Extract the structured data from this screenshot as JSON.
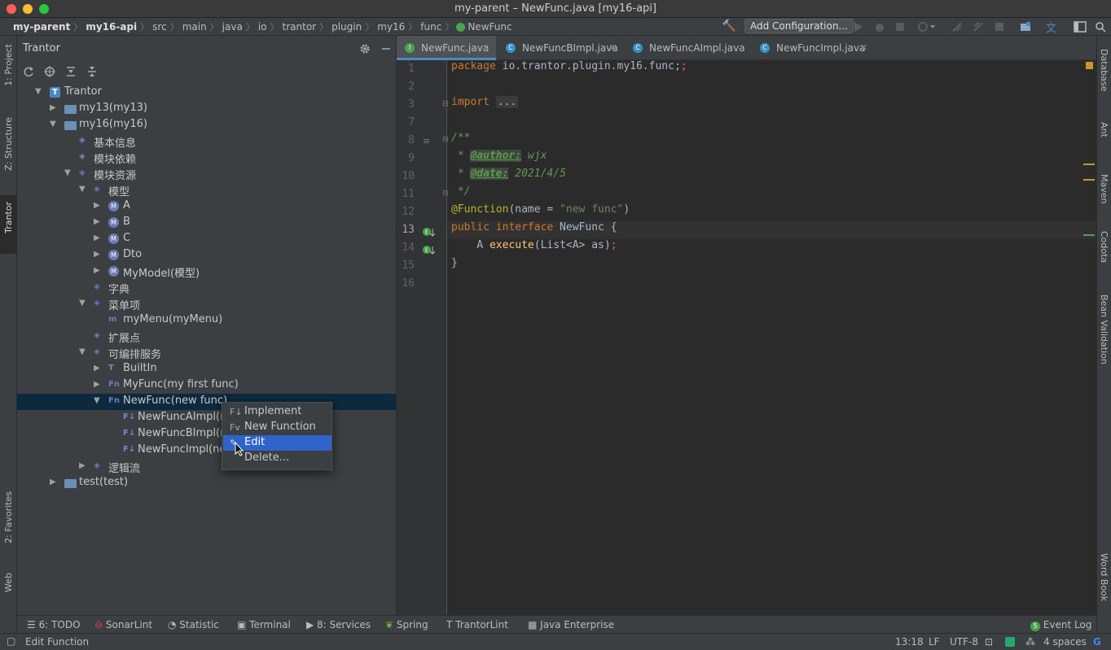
{
  "window": {
    "title": "my-parent – NewFunc.java [my16-api]"
  },
  "breadcrumbs": [
    "my-parent",
    "my16-api",
    "src",
    "main",
    "java",
    "io",
    "trantor",
    "plugin",
    "my16",
    "func",
    "NewFunc"
  ],
  "toolbar": {
    "add_configuration": "Add Configuration..."
  },
  "left_tabs": {
    "project": "1: Project",
    "structure": "Z: Structure",
    "trantor": "Trantor",
    "favorites": "2: Favorites",
    "web": "Web"
  },
  "right_tabs": {
    "database": "Database",
    "ant": "Ant",
    "maven": "Maven",
    "codota": "Codota",
    "bean_validation": "Bean Validation",
    "word_book": "Word Book"
  },
  "project_panel": {
    "title": "Trantor",
    "tree": [
      {
        "label": "Trantor",
        "depth": 0,
        "state": "open",
        "icon": "trantor-icon"
      },
      {
        "label": "my13(my13)",
        "depth": 1,
        "state": "closed",
        "icon": "folder-icon"
      },
      {
        "label": "my16(my16)",
        "depth": 1,
        "state": "open",
        "icon": "folder-icon"
      },
      {
        "label": "基本信息",
        "depth": 2,
        "state": "none",
        "icon": "info-icon"
      },
      {
        "label": "模块依赖",
        "depth": 2,
        "state": "none",
        "icon": "dependency-icon"
      },
      {
        "label": "模块资源",
        "depth": 2,
        "state": "open",
        "icon": "globe-icon"
      },
      {
        "label": "模型",
        "depth": 3,
        "state": "open",
        "icon": "model-icon"
      },
      {
        "label": "A",
        "depth": 4,
        "state": "closed",
        "icon": "model-m-icon"
      },
      {
        "label": "B",
        "depth": 4,
        "state": "closed",
        "icon": "model-m-icon"
      },
      {
        "label": "C",
        "depth": 4,
        "state": "closed",
        "icon": "model-m-icon"
      },
      {
        "label": "Dto",
        "depth": 4,
        "state": "closed",
        "icon": "model-m-icon"
      },
      {
        "label": "MyModel(模型)",
        "depth": 4,
        "state": "closed",
        "icon": "model-m-icon"
      },
      {
        "label": "字典",
        "depth": 3,
        "state": "none",
        "icon": "dictionary-icon"
      },
      {
        "label": "菜单项",
        "depth": 3,
        "state": "open",
        "icon": "menu-icon"
      },
      {
        "label": "myMenu(myMenu)",
        "depth": 4,
        "state": "none",
        "icon": "menu-item-icon"
      },
      {
        "label": "扩展点",
        "depth": 3,
        "state": "none",
        "icon": "extension-icon"
      },
      {
        "label": "可编排服务",
        "depth": 3,
        "state": "open",
        "icon": "service-icon"
      },
      {
        "label": "BuiltIn",
        "depth": 4,
        "state": "closed",
        "icon": "builtin-icon"
      },
      {
        "label": "MyFunc(my first func)",
        "depth": 4,
        "state": "closed",
        "icon": "function-icon"
      },
      {
        "label": "NewFunc(new func)",
        "depth": 4,
        "state": "open",
        "icon": "function-icon",
        "selected": true
      },
      {
        "label": "NewFuncAImpl(new",
        "depth": 5,
        "state": "none",
        "icon": "impl-icon"
      },
      {
        "label": "NewFuncBImpl(new",
        "depth": 5,
        "state": "none",
        "icon": "impl-icon"
      },
      {
        "label": "NewFuncImpl(new",
        "depth": 5,
        "state": "none",
        "icon": "impl-icon"
      },
      {
        "label": "逻辑流",
        "depth": 3,
        "state": "closed",
        "icon": "flow-icon"
      },
      {
        "label": "test(test)",
        "depth": 1,
        "state": "closed",
        "icon": "folder-icon"
      }
    ]
  },
  "context_menu": {
    "items": [
      {
        "label": "Implement",
        "icon": "implement-icon"
      },
      {
        "label": "New Function",
        "icon": "new-function-icon"
      },
      {
        "label": "Edit",
        "icon": "pencil-icon",
        "highlighted": true
      },
      {
        "label": "Delete...",
        "icon": ""
      }
    ]
  },
  "editor": {
    "tabs": [
      {
        "label": "NewFunc.java",
        "active": true,
        "icon_letter": "I",
        "icon_color": "#4ba34b"
      },
      {
        "label": "NewFuncBImpl.java",
        "active": false,
        "icon_letter": "C",
        "icon_color": "#3592c4"
      },
      {
        "label": "NewFuncAImpl.java",
        "active": false,
        "icon_letter": "C",
        "icon_color": "#3592c4"
      },
      {
        "label": "NewFuncImpl.java",
        "active": false,
        "icon_letter": "C",
        "icon_color": "#3592c4"
      }
    ],
    "line_numbers": [
      "1",
      "2",
      "3",
      "7",
      "8",
      "9",
      "10",
      "11",
      "12",
      "13",
      "14",
      "15",
      "16"
    ],
    "current_line": "13",
    "code": {
      "l1_kw": "package",
      "l1_rest": " io.trantor.plugin.my16.func;",
      "l3_kw": "import",
      "l3_fold": "...",
      "l8": "/**",
      "l9_star": " * ",
      "l9_tag": "@author:",
      "l9_val": " wjx",
      "l10_star": " * ",
      "l10_tag": "@date:",
      "l10_val": " 2021/4/5",
      "l11": " */",
      "l12_ann": "@Function",
      "l12_open": "(name = ",
      "l12_str": "\"new func\"",
      "l12_close": ")",
      "l13_kw": "public interface",
      "l13_name": " NewFunc {",
      "l14_type": "    A ",
      "l14_fn": "execute",
      "l14_rest": "(List<A> as)",
      "l14_semi": ";",
      "l15": "}"
    }
  },
  "bottom_tabs": [
    "6: TODO",
    "SonarLint",
    "Statistic",
    "Terminal",
    "8: Services",
    "Spring",
    "TrantorLint",
    "Java Enterprise"
  ],
  "event_log": {
    "count": "5",
    "label": "Event Log"
  },
  "status": {
    "message": "Edit Function",
    "position": "13:18",
    "line_sep": "LF",
    "encoding": "UTF-8",
    "indent": "4 spaces"
  }
}
